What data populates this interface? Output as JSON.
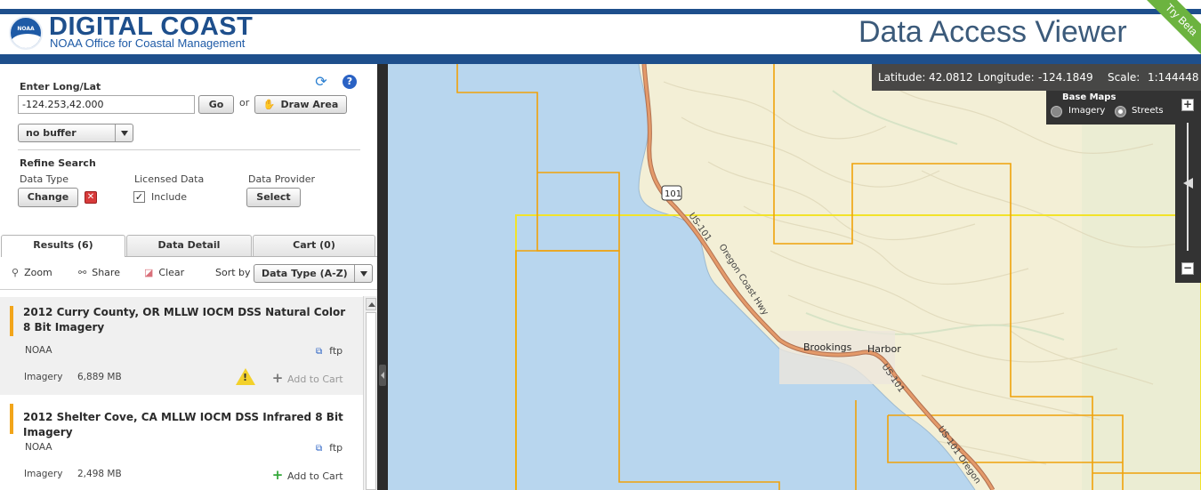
{
  "header": {
    "brand_title": "DIGITAL COAST",
    "brand_subtitle": "NOAA Office for Coastal Management",
    "logo_text": "NOAA",
    "app_title": "Data Access Viewer",
    "beta_label": "Try Beta"
  },
  "search": {
    "long_lat_label": "Enter Long/Lat",
    "long_lat_value": "-124.253,42.000",
    "go_label": "Go",
    "or_label": "or",
    "draw_area_label": "Draw Area",
    "buffer_value": "no buffer"
  },
  "refine": {
    "heading": "Refine Search",
    "data_type_label": "Data Type",
    "change_label": "Change",
    "licensed_label": "Licensed Data",
    "include_label": "Include",
    "include_checked": true,
    "provider_label": "Data Provider",
    "select_label": "Select"
  },
  "tabs": [
    {
      "label": "Results (6)",
      "active": true
    },
    {
      "label": "Data Detail",
      "active": false
    },
    {
      "label": "Cart (0)",
      "active": false
    }
  ],
  "toolbar": {
    "zoom_label": "Zoom",
    "share_label": "Share",
    "clear_label": "Clear",
    "sort_label": "Sort by",
    "sort_value": "Data Type (A-Z)"
  },
  "results": [
    {
      "title": "2012 Curry County, OR MLLW IOCM DSS Natural Color 8 Bit Imagery",
      "provider": "NOAA",
      "link": "ftp",
      "type": "Imagery",
      "size": "6,889 MB",
      "warning": true,
      "add_label": "Add to Cart",
      "add_enabled": false
    },
    {
      "title": "2012 Shelter Cove, CA MLLW IOCM DSS Infrared 8 Bit Imagery",
      "provider": "NOAA",
      "link": "ftp",
      "type": "Imagery",
      "size": "2,498 MB",
      "warning": false,
      "add_label": "Add to Cart",
      "add_enabled": true
    }
  ],
  "map": {
    "latitude_label": "Latitude:",
    "latitude_value": "42.0812",
    "longitude_label": "Longitude:",
    "longitude_value": "-124.1849",
    "scale_label": "Scale:",
    "scale_value": "1:144448",
    "basemaps_label": "Base Maps",
    "basemap_imagery": "Imagery",
    "basemap_streets": "Streets",
    "basemap_selected": "Streets",
    "zoom_in": "+",
    "zoom_out": "−",
    "labels": {
      "brookings": "Brookings",
      "harbor": "Harbor",
      "shield": "101",
      "road_us101": "US-101",
      "road_oregon": "Oregon Coast Hwy",
      "road_us101_lower": "US-101",
      "road_us101_oregon": "US-101 Oregon"
    }
  },
  "colors": {
    "brand_blue": "#1e4f8c",
    "ocean": "#b8d6ee",
    "land": "#f3efd6",
    "orange_box": "#f0a20a",
    "yellow_box": "#f2e32a",
    "road": "#e49a6a",
    "accent": "#f2a51a"
  }
}
